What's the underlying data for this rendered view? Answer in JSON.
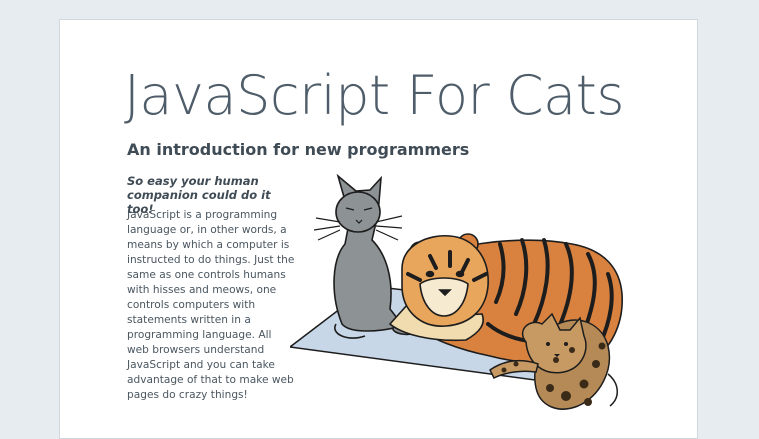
{
  "page": {
    "title": "JavaScript For Cats",
    "subtitle": "An introduction for new programmers",
    "tagline": "So easy your human companion could do it too!",
    "intro": "JavaScript is a programming language or, in other words, a means by which a computer is instructed to do things. Just the same as one controls humans with hisses and meows, one controls computers with statements written in a programming language. All web browsers understand JavaScript and you can take advantage of that to make web pages do crazy things!"
  },
  "illustration": {
    "subjects": [
      "gray cat",
      "tiger",
      "ocelot",
      "blue mat"
    ],
    "colors": {
      "gray_cat": "#8d9295",
      "tiger": "#d9823f",
      "ocelot": "#b58a57",
      "mat": "#c8d7e8",
      "outline": "#1d1d1d"
    }
  }
}
